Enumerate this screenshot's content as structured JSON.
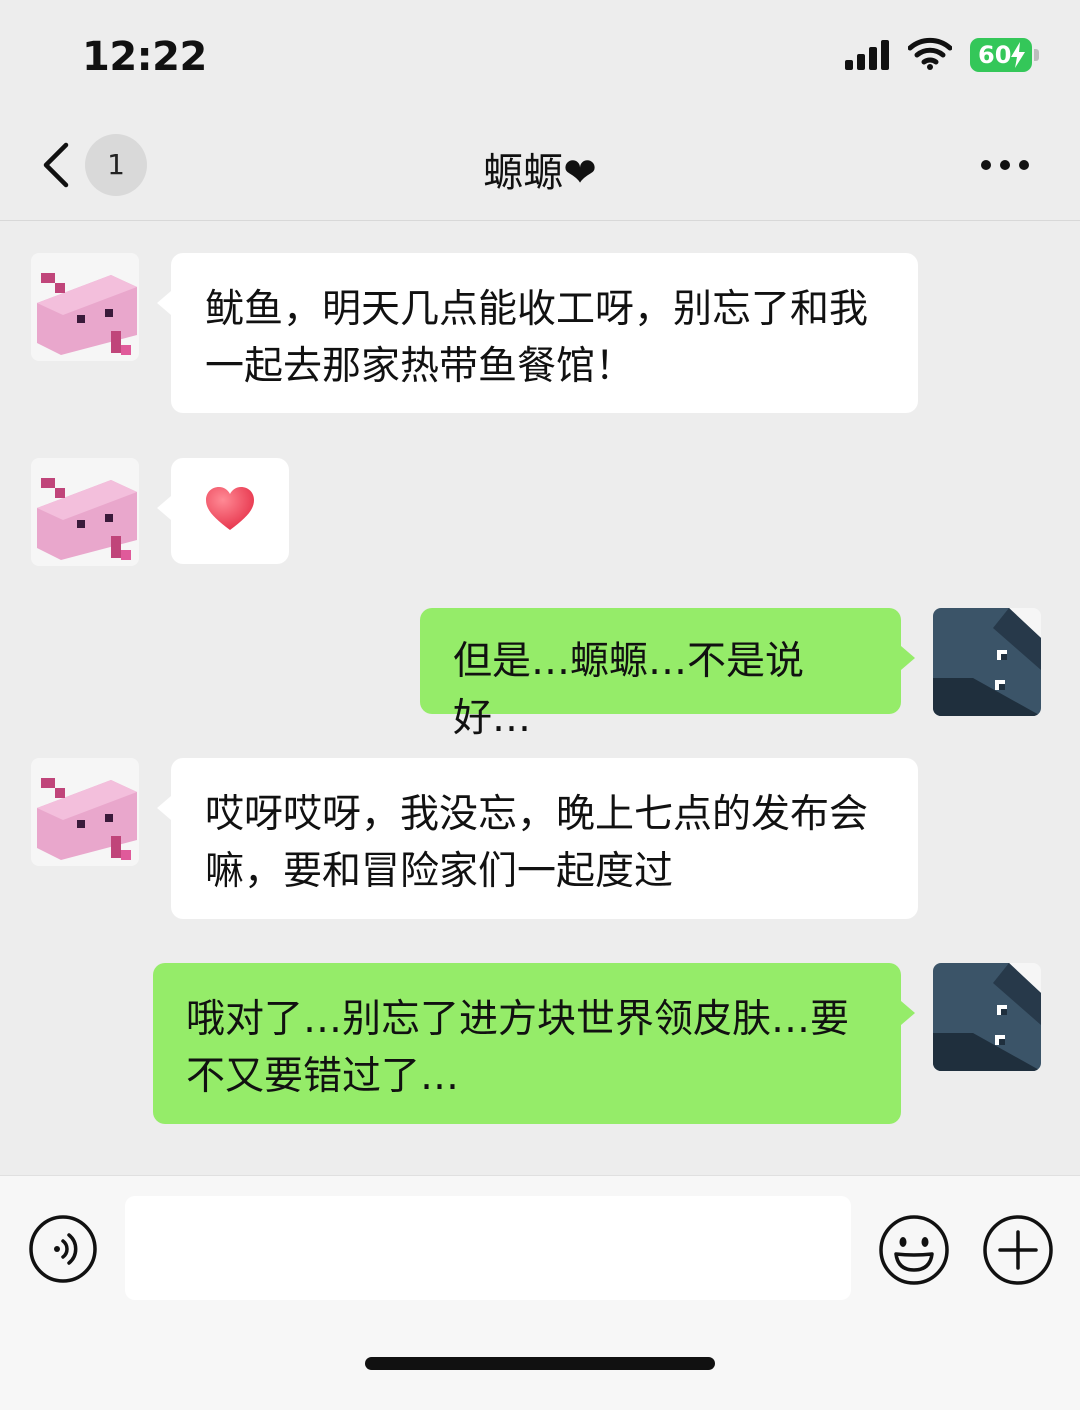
{
  "status_bar": {
    "time": "12:22",
    "battery_level": "60"
  },
  "header": {
    "unread_count": "1",
    "title": "螈螈❤"
  },
  "messages": [
    {
      "sender": "contact",
      "text": "鱿鱼，明天几点能收工呀，别忘了和我一起去那家热带鱼餐馆！"
    },
    {
      "sender": "contact",
      "type": "emoji",
      "emoji": "heart-icon"
    },
    {
      "sender": "me",
      "text": "但是…螈螈…不是说好…"
    },
    {
      "sender": "contact",
      "text": "哎呀哎呀，我没忘，晚上七点的发布会嘛，要和冒险家们一起度过"
    },
    {
      "sender": "me",
      "text": "哦对了…别忘了进方块世界领皮肤…要不又要错过了…"
    }
  ],
  "input": {
    "value": "",
    "placeholder": ""
  },
  "colors": {
    "outgoing_bubble": "#95ec69",
    "incoming_bubble": "#ffffff",
    "background": "#ededed",
    "battery": "#34c759"
  }
}
